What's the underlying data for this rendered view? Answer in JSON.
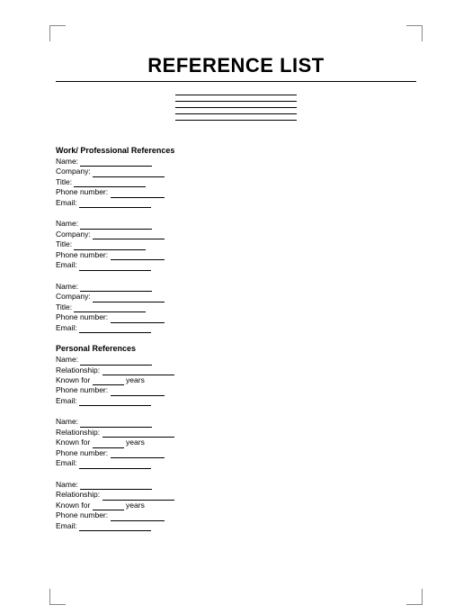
{
  "title": "REFERENCE LIST",
  "sections": {
    "work": {
      "heading": "Work/ Professional References",
      "fields": {
        "name": "Name:",
        "company": "Company:",
        "title": "Title:",
        "phone": "Phone number:",
        "email": "Email:"
      }
    },
    "personal": {
      "heading": "Personal References",
      "fields": {
        "name": "Name:",
        "relationship": "Relationship:",
        "known_prefix": "Known for",
        "known_suffix": "years",
        "phone": "Phone number:",
        "email": "Email:"
      }
    }
  }
}
